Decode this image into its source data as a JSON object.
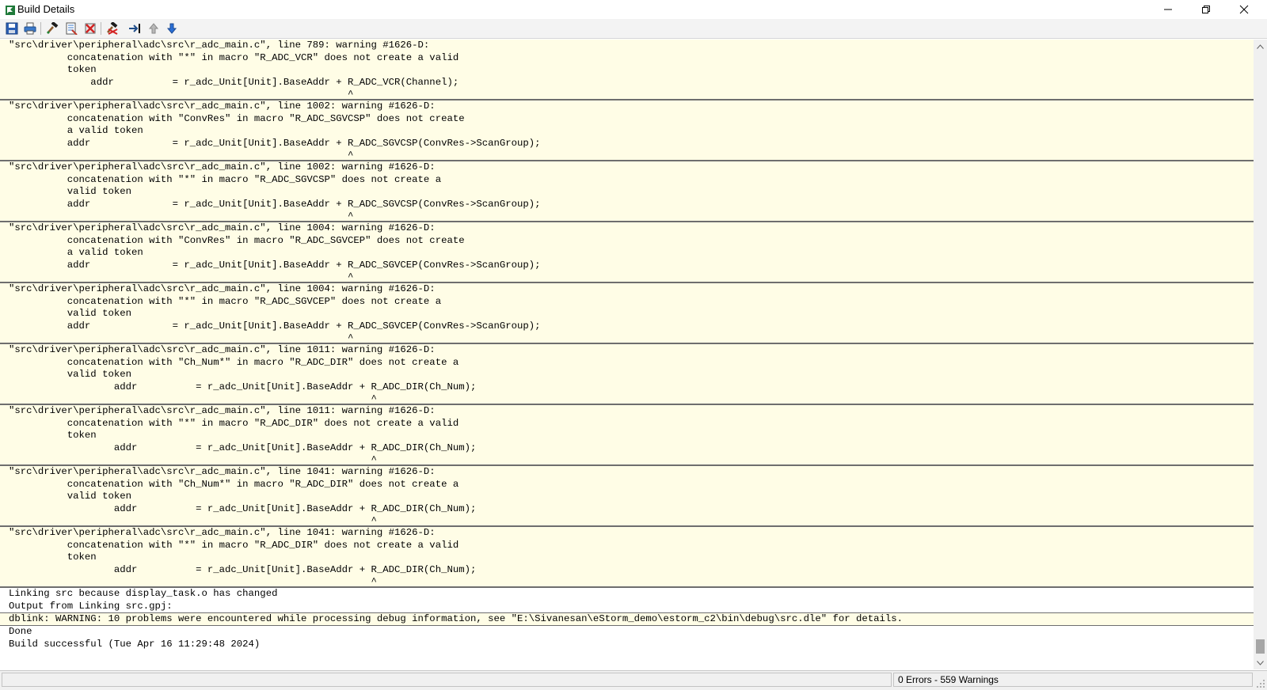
{
  "window": {
    "title": "Build Details",
    "controls": [
      "minimize-icon",
      "restore-icon",
      "close-icon"
    ]
  },
  "toolbar": {
    "buttons": [
      {
        "name": "save-icon"
      },
      {
        "name": "print-icon"
      },
      {
        "name": "build-hammer-icon"
      },
      {
        "name": "details-icon"
      },
      {
        "name": "clear-icon"
      },
      {
        "name": "stop-build-icon"
      },
      {
        "name": "goto-source-icon"
      },
      {
        "name": "previous-error-icon"
      },
      {
        "name": "next-error-icon"
      }
    ]
  },
  "output": {
    "blocks": [
      [
        "\"src\\driver\\peripheral\\adc\\src\\r_adc_main.c\", line 789: warning #1626-D:",
        "          concatenation with \"*\" in macro \"R_ADC_VCR\" does not create a valid",
        "          token",
        "              addr          = r_adc_Unit[Unit].BaseAddr + R_ADC_VCR(Channel);",
        "                                                          ^"
      ],
      [
        "\"src\\driver\\peripheral\\adc\\src\\r_adc_main.c\", line 1002: warning #1626-D:",
        "          concatenation with \"ConvRes\" in macro \"R_ADC_SGVCSP\" does not create",
        "          a valid token",
        "          addr              = r_adc_Unit[Unit].BaseAddr + R_ADC_SGVCSP(ConvRes->ScanGroup);",
        "                                                          ^"
      ],
      [
        "\"src\\driver\\peripheral\\adc\\src\\r_adc_main.c\", line 1002: warning #1626-D:",
        "          concatenation with \"*\" in macro \"R_ADC_SGVCSP\" does not create a",
        "          valid token",
        "          addr              = r_adc_Unit[Unit].BaseAddr + R_ADC_SGVCSP(ConvRes->ScanGroup);",
        "                                                          ^"
      ],
      [
        "\"src\\driver\\peripheral\\adc\\src\\r_adc_main.c\", line 1004: warning #1626-D:",
        "          concatenation with \"ConvRes\" in macro \"R_ADC_SGVCEP\" does not create",
        "          a valid token",
        "          addr              = r_adc_Unit[Unit].BaseAddr + R_ADC_SGVCEP(ConvRes->ScanGroup);",
        "                                                          ^"
      ],
      [
        "\"src\\driver\\peripheral\\adc\\src\\r_adc_main.c\", line 1004: warning #1626-D:",
        "          concatenation with \"*\" in macro \"R_ADC_SGVCEP\" does not create a",
        "          valid token",
        "          addr              = r_adc_Unit[Unit].BaseAddr + R_ADC_SGVCEP(ConvRes->ScanGroup);",
        "                                                          ^"
      ],
      [
        "\"src\\driver\\peripheral\\adc\\src\\r_adc_main.c\", line 1011: warning #1626-D:",
        "          concatenation with \"Ch_Num*\" in macro \"R_ADC_DIR\" does not create a",
        "          valid token",
        "                  addr          = r_adc_Unit[Unit].BaseAddr + R_ADC_DIR(Ch_Num);",
        "                                                              ^"
      ],
      [
        "\"src\\driver\\peripheral\\adc\\src\\r_adc_main.c\", line 1011: warning #1626-D:",
        "          concatenation with \"*\" in macro \"R_ADC_DIR\" does not create a valid",
        "          token",
        "                  addr          = r_adc_Unit[Unit].BaseAddr + R_ADC_DIR(Ch_Num);",
        "                                                              ^"
      ],
      [
        "\"src\\driver\\peripheral\\adc\\src\\r_adc_main.c\", line 1041: warning #1626-D:",
        "          concatenation with \"Ch_Num*\" in macro \"R_ADC_DIR\" does not create a",
        "          valid token",
        "                  addr          = r_adc_Unit[Unit].BaseAddr + R_ADC_DIR(Ch_Num);",
        "                                                              ^"
      ],
      [
        "\"src\\driver\\peripheral\\adc\\src\\r_adc_main.c\", line 1041: warning #1626-D:",
        "          concatenation with \"*\" in macro \"R_ADC_DIR\" does not create a valid",
        "          token",
        "                  addr          = r_adc_Unit[Unit].BaseAddr + R_ADC_DIR(Ch_Num);",
        "                                                              ^"
      ]
    ],
    "link_lines": [
      "Linking src because display_task.o has changed",
      "Output from Linking src.gpj:"
    ],
    "dblink_warning": "dblink: WARNING: 10 problems were encountered while processing debug information, see \"E:\\Sivanesan\\eStorm_demo\\estorm_c2\\bin\\debug\\src.dle\" for details.",
    "done_lines": [
      "Done",
      "Build successful (Tue Apr 16 11:29:48 2024)"
    ]
  },
  "status": {
    "summary": "0 Errors  -  559 Warnings"
  },
  "colors": {
    "warning_background": "#fffde6",
    "separator": "#6e6e6e",
    "toolbar_background": "#f3f3f3"
  }
}
